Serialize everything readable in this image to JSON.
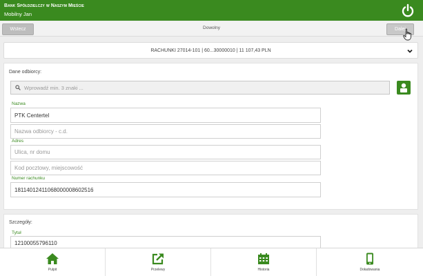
{
  "header": {
    "bank_name": "Bank Spółdzielczy w Naszym Mieście",
    "user_name": "Mobilny Jan"
  },
  "toolbar": {
    "back_label": "Wstecz",
    "title": "Dowolny",
    "next_label": "Dalej"
  },
  "account": {
    "text": "RACHUNKI 27014-101 | 60...30000010 | 11 107,43 PLN"
  },
  "recipient": {
    "section_label": "Dane odbiorcy:",
    "search_placeholder": "Wprowadź min. 3 znaki ...",
    "name_label": "Nazwa",
    "name_value": "PTK Centertel",
    "name2_placeholder": "Nazwa odbiorcy - c.d.",
    "address_label": "Adres",
    "street_placeholder": "Ulica, nr domu",
    "city_placeholder": "Kod pocztowy, miejscowość",
    "account_label": "Numer rachunku",
    "account_value": "18114012411068000008602516"
  },
  "details": {
    "section_label": "Szczegóły:",
    "title_label": "Tytuł",
    "title_value": "12100055796110"
  },
  "bottom_nav": {
    "items": [
      {
        "label": "Pulpit",
        "icon": "home-icon"
      },
      {
        "label": "Przelewy",
        "icon": "external-link-icon"
      },
      {
        "label": "Historia",
        "icon": "calendar-icon"
      },
      {
        "label": "Doładowania",
        "icon": "phone-icon"
      }
    ]
  },
  "colors": {
    "brand_green": "#3a8a1f",
    "button_gray": "#bdbdbd"
  }
}
